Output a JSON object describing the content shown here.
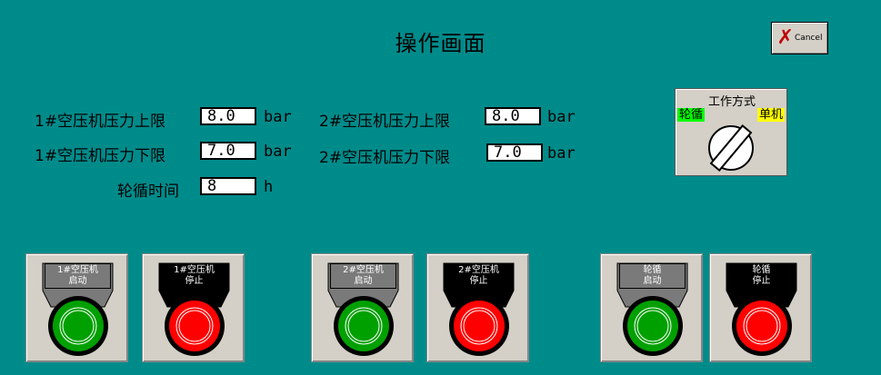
{
  "title": "操作画面",
  "cancel": {
    "label": "Cancel"
  },
  "params": {
    "c1_upper": {
      "label": "1#空压机压力上限",
      "value": "8.0",
      "unit": "bar"
    },
    "c1_lower": {
      "label": "1#空压机压力下限",
      "value": "7.0",
      "unit": "bar"
    },
    "c2_upper": {
      "label": "2#空压机压力上限",
      "value": "8.0",
      "unit": "bar"
    },
    "c2_lower": {
      "label": "2#空压机压力下限",
      "value": "7.0",
      "unit": "bar"
    },
    "cycle_time": {
      "label": "轮循时间",
      "value": "8",
      "unit": "h"
    }
  },
  "mode": {
    "title": "工作方式",
    "left": "轮循",
    "right": "单机",
    "selected": "单机"
  },
  "buttons": [
    {
      "line1": "1#空压机",
      "line2": "启动",
      "type": "start"
    },
    {
      "line1": "1#空压机",
      "line2": "停止",
      "type": "stop"
    },
    {
      "line1": "2#空压机",
      "line2": "启动",
      "type": "start"
    },
    {
      "line1": "2#空压机",
      "line2": "停止",
      "type": "stop"
    },
    {
      "line1": "轮循",
      "line2": "启动",
      "type": "start"
    },
    {
      "line1": "轮循",
      "line2": "停止",
      "type": "stop"
    }
  ],
  "colors": {
    "background": "#008B8B",
    "start": "#00A000",
    "stop": "#FF0000",
    "panel": "#D4D0C8"
  }
}
